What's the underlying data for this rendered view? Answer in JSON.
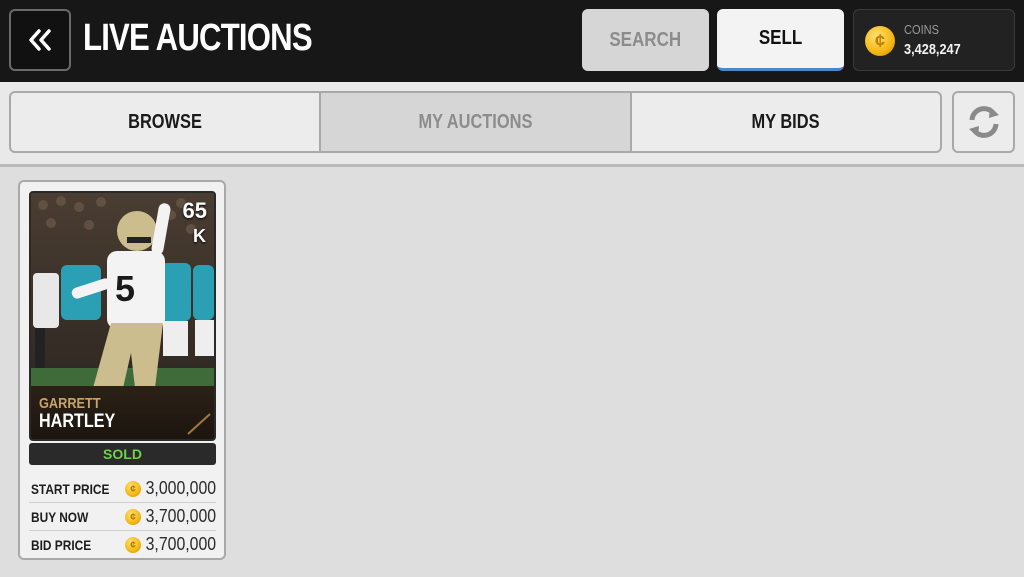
{
  "header": {
    "title": "LIVE AUCTIONS",
    "back_icon": "double-chevron-left-icon",
    "search_label": "SEARCH",
    "sell_label": "SELL",
    "coins_label": "COINS",
    "coins_value": "3,428,247"
  },
  "tabs": [
    {
      "label": "BROWSE",
      "active": false
    },
    {
      "label": "MY AUCTIONS",
      "active": true
    },
    {
      "label": "MY BIDS",
      "active": false
    }
  ],
  "refresh_icon": "refresh-icon",
  "card": {
    "overall": "65",
    "position": "K",
    "jersey_number": "5",
    "first_name": "GARRETT",
    "last_name": "HARTLEY",
    "status": "SOLD",
    "prices": [
      {
        "label": "START PRICE",
        "value": "3,000,000"
      },
      {
        "label": "BUY NOW",
        "value": "3,700,000"
      },
      {
        "label": "BID PRICE",
        "value": "3,700,000"
      }
    ]
  },
  "colors": {
    "header_bg": "#171717",
    "sell_underline": "#4b86c5",
    "coin_gold": "#f4b60f",
    "sold_green": "#6fd04a"
  }
}
